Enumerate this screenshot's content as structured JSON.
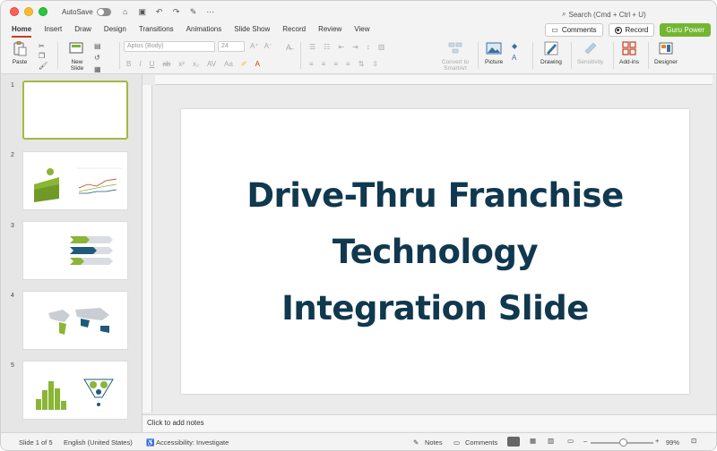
{
  "titlebar": {
    "autosave_label": "AutoSave",
    "search_placeholder": "Search (Cmd + Ctrl + U)"
  },
  "tabs": [
    {
      "label": "Home",
      "active": true
    },
    {
      "label": "Insert"
    },
    {
      "label": "Draw"
    },
    {
      "label": "Design"
    },
    {
      "label": "Transitions"
    },
    {
      "label": "Animations"
    },
    {
      "label": "Slide Show"
    },
    {
      "label": "Record"
    },
    {
      "label": "Review"
    },
    {
      "label": "View"
    }
  ],
  "header_buttons": {
    "comments": "Comments",
    "record": "Record",
    "guru_power": "Guru Power"
  },
  "ribbon": {
    "paste": "Paste",
    "new_slide": "New\nSlide",
    "font_name": "Aptos (Body)",
    "font_size": "24",
    "convert_smartart": "Convert to\nSmartArt",
    "picture": "Picture",
    "drawing": "Drawing",
    "sensitivity": "Sensitivity",
    "add_ins": "Add-ins",
    "designer": "Designer"
  },
  "thumbnails": [
    {
      "number": "1"
    },
    {
      "number": "2"
    },
    {
      "number": "3"
    },
    {
      "number": "4"
    },
    {
      "number": "5"
    }
  ],
  "slide": {
    "title_line1": "Drive-Thru Franchise",
    "title_line2": "Technology",
    "title_line3": "Integration Slide"
  },
  "notes_placeholder": "Click to add notes",
  "status": {
    "slide_position": "Slide 1 of 5",
    "language": "English (United States)",
    "accessibility": "Accessibility: Investigate",
    "notes": "Notes",
    "comments": "Comments",
    "zoom": "99%"
  },
  "colors": {
    "accent": "#c43e1c",
    "title_text": "#10384f",
    "guru_green": "#74b532",
    "thumb_green": "#8bb536",
    "thumb_blue": "#1f5a7a"
  }
}
